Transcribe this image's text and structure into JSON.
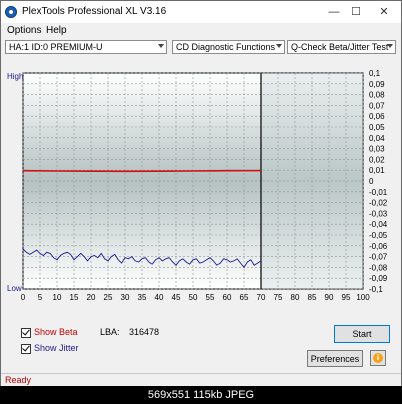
{
  "window": {
    "title": "PlexTools Professional XL V3.16",
    "controls": {
      "minimize": "—",
      "maximize": "☐",
      "close": "✕"
    }
  },
  "menu": {
    "items": [
      "Options",
      "Help"
    ]
  },
  "toolbar": {
    "drive": "HA:1 ID:0  PREMIUM-U",
    "function": "CD Diagnostic Functions",
    "test": "Q-Check Beta/Jitter Test"
  },
  "chart_data": {
    "type": "line",
    "y_left_labels": {
      "top": "High",
      "bottom": "Low"
    },
    "x_ticks": [
      0,
      5,
      10,
      15,
      20,
      25,
      30,
      35,
      40,
      45,
      50,
      55,
      60,
      65,
      70,
      75,
      80,
      85,
      90,
      95,
      100
    ],
    "y_right_ticks": [
      "0,1",
      "0,09",
      "0,08",
      "0,07",
      "0,06",
      "0,05",
      "0,04",
      "0,03",
      "0,02",
      "0,01",
      "0",
      "-0,01",
      "-0,02",
      "-0,03",
      "-0,04",
      "-0,05",
      "-0,06",
      "-0,07",
      "-0,08",
      "-0,09",
      "-0,1"
    ],
    "xlim": [
      0,
      100
    ],
    "ylim": [
      -0.1,
      0.1
    ],
    "grid": true,
    "cursor_x": 70,
    "series": [
      {
        "color": "#d01010",
        "x": [
          0,
          10,
          20,
          30,
          40,
          50,
          60,
          70
        ],
        "y": [
          0.0095,
          0.0093,
          0.0091,
          0.009,
          0.0091,
          0.0093,
          0.0095,
          0.0096
        ]
      },
      {
        "color": "#1a1a8c",
        "x": [
          0,
          1,
          2,
          3,
          4,
          5,
          6,
          7,
          8,
          9,
          10,
          11,
          12,
          13,
          14,
          15,
          16,
          17,
          18,
          19,
          20,
          21,
          22,
          23,
          24,
          25,
          26,
          27,
          28,
          29,
          30,
          31,
          32,
          33,
          34,
          35,
          36,
          37,
          38,
          39,
          40,
          41,
          42,
          43,
          44,
          45,
          46,
          47,
          48,
          49,
          50,
          51,
          52,
          53,
          54,
          55,
          56,
          57,
          58,
          59,
          60,
          61,
          62,
          63,
          64,
          65,
          66,
          67,
          68,
          69,
          70
        ],
        "y": [
          -0.063,
          -0.066,
          -0.068,
          -0.066,
          -0.064,
          -0.067,
          -0.069,
          -0.066,
          -0.067,
          -0.071,
          -0.073,
          -0.069,
          -0.067,
          -0.066,
          -0.068,
          -0.073,
          -0.07,
          -0.067,
          -0.07,
          -0.074,
          -0.07,
          -0.069,
          -0.071,
          -0.067,
          -0.072,
          -0.074,
          -0.07,
          -0.068,
          -0.073,
          -0.076,
          -0.071,
          -0.072,
          -0.07,
          -0.074,
          -0.075,
          -0.072,
          -0.071,
          -0.075,
          -0.077,
          -0.073,
          -0.071,
          -0.074,
          -0.072,
          -0.071,
          -0.075,
          -0.078,
          -0.074,
          -0.072,
          -0.075,
          -0.077,
          -0.073,
          -0.072,
          -0.076,
          -0.075,
          -0.073,
          -0.071,
          -0.074,
          -0.078,
          -0.076,
          -0.072,
          -0.073,
          -0.075,
          -0.074,
          -0.072,
          -0.076,
          -0.08,
          -0.075,
          -0.073,
          -0.078,
          -0.076,
          -0.074
        ]
      }
    ]
  },
  "options": {
    "show_beta_label": "Show Beta",
    "show_beta_checked": true,
    "show_jitter_label": "Show Jitter",
    "show_jitter_checked": true
  },
  "lba": {
    "label": "LBA:",
    "value": "316478"
  },
  "buttons": {
    "start": "Start",
    "preferences": "Preferences",
    "info": "i"
  },
  "status": {
    "text": "Ready"
  },
  "caption": {
    "text": "569x551  115kb  JPEG"
  }
}
